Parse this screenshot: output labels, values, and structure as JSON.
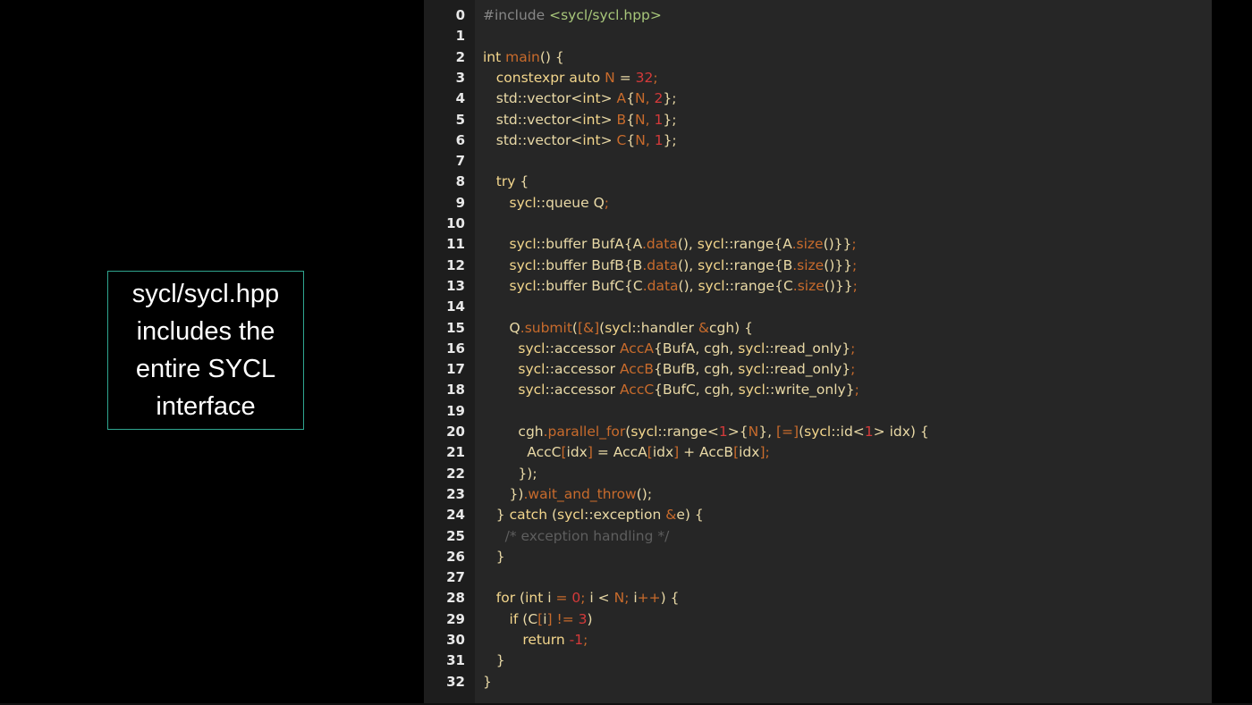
{
  "callout": {
    "text": "sycl/sycl.hpp\nincludes the\nentire SYCL\ninterface",
    "border_color": "#2fa58f"
  },
  "editor": {
    "highlight_color": "#1fae8f",
    "lines": [
      {
        "n": "0",
        "tokens": [
          {
            "t": "#include ",
            "c": "dim"
          },
          {
            "t": "<sycl/sycl.hpp>",
            "c": "str"
          }
        ]
      },
      {
        "n": "1",
        "tokens": []
      },
      {
        "n": "2",
        "tokens": [
          {
            "t": "int ",
            "c": "kw"
          },
          {
            "t": "main",
            "c": "fn"
          },
          {
            "t": "() {",
            "c": "pun"
          }
        ]
      },
      {
        "n": "3",
        "tokens": [
          {
            "t": "   constexpr auto ",
            "c": "kw"
          },
          {
            "t": "N",
            "c": "var"
          },
          {
            "t": " = ",
            "c": "pun"
          },
          {
            "t": "32",
            "c": "num"
          },
          {
            "t": ";",
            "c": "op"
          }
        ]
      },
      {
        "n": "4",
        "tokens": [
          {
            "t": "   std::vector<",
            "c": "pun"
          },
          {
            "t": "int",
            "c": "kw"
          },
          {
            "t": "> ",
            "c": "pun"
          },
          {
            "t": "A",
            "c": "var"
          },
          {
            "t": "{",
            "c": "pun"
          },
          {
            "t": "N",
            "c": "var"
          },
          {
            "t": ", ",
            "c": "op"
          },
          {
            "t": "2",
            "c": "num"
          },
          {
            "t": "};",
            "c": "pun"
          }
        ]
      },
      {
        "n": "5",
        "tokens": [
          {
            "t": "   std::vector<",
            "c": "pun"
          },
          {
            "t": "int",
            "c": "kw"
          },
          {
            "t": "> ",
            "c": "pun"
          },
          {
            "t": "B",
            "c": "var"
          },
          {
            "t": "{",
            "c": "pun"
          },
          {
            "t": "N",
            "c": "var"
          },
          {
            "t": ", ",
            "c": "op"
          },
          {
            "t": "1",
            "c": "num"
          },
          {
            "t": "};",
            "c": "pun"
          }
        ]
      },
      {
        "n": "6",
        "tokens": [
          {
            "t": "   std::vector<",
            "c": "pun"
          },
          {
            "t": "int",
            "c": "kw"
          },
          {
            "t": "> ",
            "c": "pun"
          },
          {
            "t": "C",
            "c": "var"
          },
          {
            "t": "{",
            "c": "pun"
          },
          {
            "t": "N",
            "c": "var"
          },
          {
            "t": ", ",
            "c": "op"
          },
          {
            "t": "1",
            "c": "num"
          },
          {
            "t": "};",
            "c": "pun"
          }
        ]
      },
      {
        "n": "7",
        "tokens": []
      },
      {
        "n": "8",
        "tokens": [
          {
            "t": "   try ",
            "c": "kw"
          },
          {
            "t": "{",
            "c": "pun"
          }
        ]
      },
      {
        "n": "9",
        "tokens": [
          {
            "t": "      sycl",
            "c": "kw"
          },
          {
            "t": "::queue Q",
            "c": "pun"
          },
          {
            "t": ";",
            "c": "op"
          }
        ]
      },
      {
        "n": "10",
        "tokens": []
      },
      {
        "n": "11",
        "tokens": [
          {
            "t": "      sycl",
            "c": "kw"
          },
          {
            "t": "::buffer BufA{A",
            "c": "pun"
          },
          {
            "t": ".data",
            "c": "fn"
          },
          {
            "t": "(), ",
            "c": "pun"
          },
          {
            "t": "sycl",
            "c": "kw"
          },
          {
            "t": "::range{A",
            "c": "pun"
          },
          {
            "t": ".size",
            "c": "fn"
          },
          {
            "t": "()}}",
            "c": "pun"
          },
          {
            "t": ";",
            "c": "op"
          }
        ]
      },
      {
        "n": "12",
        "tokens": [
          {
            "t": "      sycl",
            "c": "kw"
          },
          {
            "t": "::buffer BufB{B",
            "c": "pun"
          },
          {
            "t": ".data",
            "c": "fn"
          },
          {
            "t": "(), ",
            "c": "pun"
          },
          {
            "t": "sycl",
            "c": "kw"
          },
          {
            "t": "::range{B",
            "c": "pun"
          },
          {
            "t": ".size",
            "c": "fn"
          },
          {
            "t": "()}}",
            "c": "pun"
          },
          {
            "t": ";",
            "c": "op"
          }
        ]
      },
      {
        "n": "13",
        "tokens": [
          {
            "t": "      sycl",
            "c": "kw"
          },
          {
            "t": "::buffer BufC{C",
            "c": "pun"
          },
          {
            "t": ".data",
            "c": "fn"
          },
          {
            "t": "(), ",
            "c": "pun"
          },
          {
            "t": "sycl",
            "c": "kw"
          },
          {
            "t": "::range{C",
            "c": "pun"
          },
          {
            "t": ".size",
            "c": "fn"
          },
          {
            "t": "()}}",
            "c": "pun"
          },
          {
            "t": ";",
            "c": "op"
          }
        ]
      },
      {
        "n": "14",
        "tokens": []
      },
      {
        "n": "15",
        "tokens": [
          {
            "t": "      Q",
            "c": "pun"
          },
          {
            "t": ".submit",
            "c": "fn"
          },
          {
            "t": "(",
            "c": "pun"
          },
          {
            "t": "[&]",
            "c": "op"
          },
          {
            "t": "(",
            "c": "pun"
          },
          {
            "t": "sycl",
            "c": "kw"
          },
          {
            "t": "::handler ",
            "c": "pun"
          },
          {
            "t": "&",
            "c": "op"
          },
          {
            "t": "cgh) {",
            "c": "pun"
          }
        ]
      },
      {
        "n": "16",
        "tokens": [
          {
            "t": "        sycl",
            "c": "kw"
          },
          {
            "t": "::accessor ",
            "c": "pun"
          },
          {
            "t": "AccA",
            "c": "var"
          },
          {
            "t": "{BufA, cgh, ",
            "c": "pun"
          },
          {
            "t": "sycl",
            "c": "kw"
          },
          {
            "t": "::read_only}",
            "c": "pun"
          },
          {
            "t": ";",
            "c": "op"
          }
        ]
      },
      {
        "n": "17",
        "tokens": [
          {
            "t": "        sycl",
            "c": "kw"
          },
          {
            "t": "::accessor ",
            "c": "pun"
          },
          {
            "t": "AccB",
            "c": "var"
          },
          {
            "t": "{BufB, cgh, ",
            "c": "pun"
          },
          {
            "t": "sycl",
            "c": "kw"
          },
          {
            "t": "::read_only}",
            "c": "pun"
          },
          {
            "t": ";",
            "c": "op"
          }
        ]
      },
      {
        "n": "18",
        "tokens": [
          {
            "t": "        sycl",
            "c": "kw"
          },
          {
            "t": "::accessor ",
            "c": "pun"
          },
          {
            "t": "AccC",
            "c": "var"
          },
          {
            "t": "{BufC, cgh, ",
            "c": "pun"
          },
          {
            "t": "sycl",
            "c": "kw"
          },
          {
            "t": "::write_only}",
            "c": "pun"
          },
          {
            "t": ";",
            "c": "op"
          }
        ]
      },
      {
        "n": "19",
        "tokens": []
      },
      {
        "n": "20",
        "tokens": [
          {
            "t": "        cgh",
            "c": "pun"
          },
          {
            "t": ".parallel_for",
            "c": "fn"
          },
          {
            "t": "(",
            "c": "pun"
          },
          {
            "t": "sycl",
            "c": "kw"
          },
          {
            "t": "::range<",
            "c": "pun"
          },
          {
            "t": "1",
            "c": "num"
          },
          {
            "t": ">{",
            "c": "pun"
          },
          {
            "t": "N",
            "c": "var"
          },
          {
            "t": "}, ",
            "c": "pun"
          },
          {
            "t": "[=]",
            "c": "op"
          },
          {
            "t": "(",
            "c": "pun"
          },
          {
            "t": "sycl",
            "c": "kw"
          },
          {
            "t": "::id<",
            "c": "pun"
          },
          {
            "t": "1",
            "c": "num"
          },
          {
            "t": "> idx) {",
            "c": "pun"
          }
        ]
      },
      {
        "n": "21",
        "tokens": [
          {
            "t": "          AccC",
            "c": "pun"
          },
          {
            "t": "[",
            "c": "op"
          },
          {
            "t": "idx",
            "c": "pun"
          },
          {
            "t": "]",
            "c": "op"
          },
          {
            "t": " = AccA",
            "c": "pun"
          },
          {
            "t": "[",
            "c": "op"
          },
          {
            "t": "idx",
            "c": "pun"
          },
          {
            "t": "]",
            "c": "op"
          },
          {
            "t": " + AccB",
            "c": "pun"
          },
          {
            "t": "[",
            "c": "op"
          },
          {
            "t": "idx",
            "c": "pun"
          },
          {
            "t": "];",
            "c": "op"
          }
        ]
      },
      {
        "n": "22",
        "tokens": [
          {
            "t": "        });",
            "c": "pun"
          }
        ]
      },
      {
        "n": "23",
        "tokens": [
          {
            "t": "      })",
            "c": "pun"
          },
          {
            "t": ".wait_and_throw",
            "c": "fn"
          },
          {
            "t": "();",
            "c": "pun"
          }
        ]
      },
      {
        "n": "24",
        "tokens": [
          {
            "t": "   } ",
            "c": "pun"
          },
          {
            "t": "catch ",
            "c": "kw"
          },
          {
            "t": "(",
            "c": "pun"
          },
          {
            "t": "sycl",
            "c": "kw"
          },
          {
            "t": "::exception ",
            "c": "pun"
          },
          {
            "t": "&",
            "c": "op"
          },
          {
            "t": "e) {",
            "c": "pun"
          }
        ]
      },
      {
        "n": "25",
        "tokens": [
          {
            "t": "     /* exception handling */",
            "c": "com"
          }
        ]
      },
      {
        "n": "26",
        "tokens": [
          {
            "t": "   }",
            "c": "pun"
          }
        ]
      },
      {
        "n": "27",
        "tokens": []
      },
      {
        "n": "28",
        "tokens": [
          {
            "t": "   for ",
            "c": "kw"
          },
          {
            "t": "(",
            "c": "pun"
          },
          {
            "t": "int ",
            "c": "kw"
          },
          {
            "t": "i ",
            "c": "pun"
          },
          {
            "t": "= ",
            "c": "op"
          },
          {
            "t": "0",
            "c": "num"
          },
          {
            "t": "; ",
            "c": "op"
          },
          {
            "t": "i < ",
            "c": "pun"
          },
          {
            "t": "N",
            "c": "var"
          },
          {
            "t": "; ",
            "c": "op"
          },
          {
            "t": "i",
            "c": "pun"
          },
          {
            "t": "++",
            "c": "op"
          },
          {
            "t": ") {",
            "c": "pun"
          }
        ]
      },
      {
        "n": "29",
        "tokens": [
          {
            "t": "      if ",
            "c": "kw"
          },
          {
            "t": "(C",
            "c": "pun"
          },
          {
            "t": "[",
            "c": "op"
          },
          {
            "t": "i",
            "c": "pun"
          },
          {
            "t": "]",
            "c": "op"
          },
          {
            "t": " != ",
            "c": "op"
          },
          {
            "t": "3",
            "c": "num"
          },
          {
            "t": ")",
            "c": "pun"
          }
        ]
      },
      {
        "n": "30",
        "tokens": [
          {
            "t": "         return ",
            "c": "kw"
          },
          {
            "t": "-1",
            "c": "num"
          },
          {
            "t": ";",
            "c": "op"
          }
        ]
      },
      {
        "n": "31",
        "tokens": [
          {
            "t": "   }",
            "c": "pun"
          }
        ]
      },
      {
        "n": "32",
        "tokens": [
          {
            "t": "}",
            "c": "pun"
          }
        ]
      }
    ]
  }
}
